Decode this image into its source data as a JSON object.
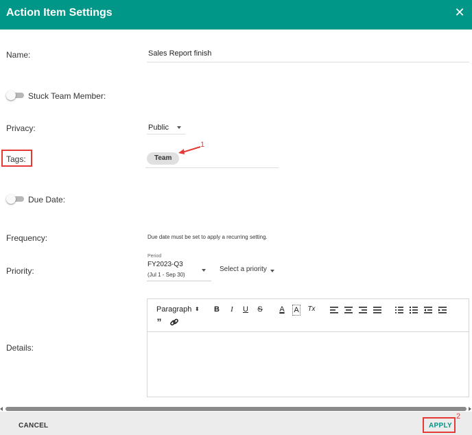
{
  "dialog": {
    "title": "Action Item Settings",
    "accent_color": "#009688",
    "close_icon": "close-icon"
  },
  "fields": {
    "name_label": "Name:",
    "name_value": "Sales Report finish",
    "stuck_label": "Stuck Team Member:",
    "stuck_on": false,
    "privacy_label": "Privacy:",
    "privacy_value": "Public",
    "tags_label": "Tags:",
    "tags": [
      "Team"
    ],
    "due_label": "Due Date:",
    "due_on": false,
    "frequency_label": "Frequency:",
    "frequency_note": "Due date must be set to apply a recurring setting.",
    "priority_label": "Priority:",
    "period_label": "Period",
    "period_value": "FY2023-Q3",
    "period_range": "(Jul 1 - Sep 30)",
    "priority_placeholder": "Select a priority",
    "details_label": "Details:"
  },
  "editor": {
    "block_format": "Paragraph",
    "tools": [
      "bold",
      "italic",
      "underline",
      "strikethrough",
      "font-color",
      "highlight",
      "clear-format",
      "align-left",
      "align-center",
      "align-right",
      "justify",
      "ordered-list",
      "bullet-list",
      "outdent",
      "indent",
      "blockquote",
      "link"
    ],
    "glyphs": {
      "bold": "B",
      "italic": "I",
      "underline": "U",
      "strikethrough": "S",
      "font_color": "A",
      "highlight": "A",
      "clear_format": "Tx",
      "quote": "”"
    }
  },
  "annotations": {
    "tags_marker": "1",
    "apply_marker": "2",
    "marker_color": "#e53935"
  },
  "footer": {
    "cancel_label": "CANCEL",
    "apply_label": "APPLY"
  }
}
